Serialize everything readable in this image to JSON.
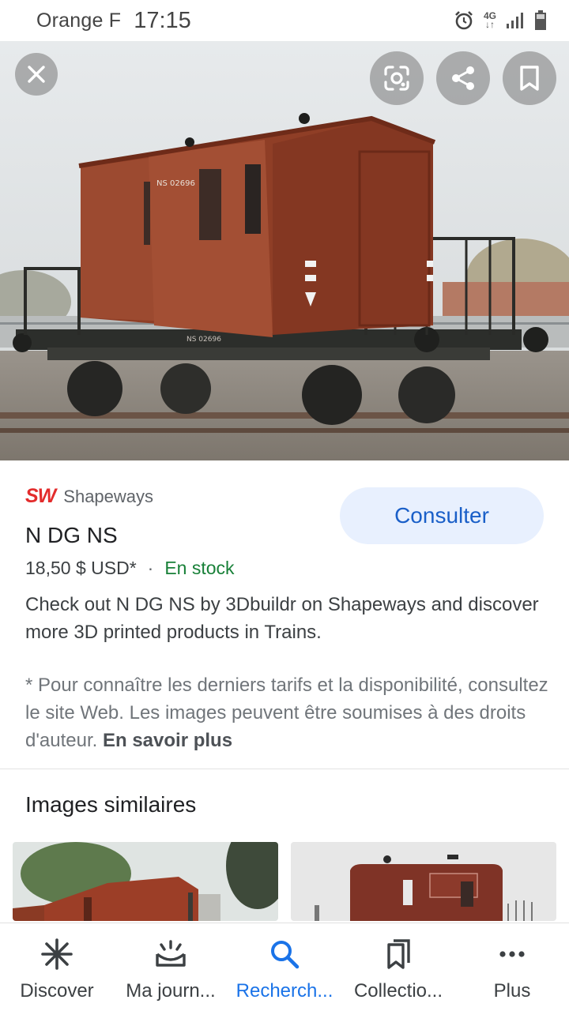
{
  "status_bar": {
    "carrier": "Orange F",
    "time": "17:15",
    "network": "4G",
    "icons": [
      "alarm-icon",
      "network-4g-icon",
      "signal-icon",
      "battery-icon"
    ]
  },
  "viewer": {
    "close_icon": "close-icon",
    "actions": [
      "lens-icon",
      "share-icon",
      "bookmark-icon"
    ],
    "image_plate_top": "NS 02696",
    "image_plate_bottom": "NS 02696"
  },
  "result": {
    "source_logo": "SW",
    "source_name": "Shapeways",
    "visit_button": "Consulter",
    "title": "N DG NS",
    "price": "18,50 $ USD*",
    "separator": "·",
    "availability": "En stock",
    "description": "Check out N DG NS by 3Dbuildr on Shapeways and discover more 3D printed products in Trains.",
    "disclaimer": "* Pour connaître les derniers tarifs et la disponibilité, consultez le site Web. Les images peuvent être soumises à des droits d'auteur.",
    "learn_more": "En savoir plus"
  },
  "similar": {
    "title": "Images similaires"
  },
  "bottom_nav": {
    "items": [
      {
        "label": "Discover",
        "icon": "asterisk-icon"
      },
      {
        "label": "Ma journ...",
        "icon": "sunrise-icon"
      },
      {
        "label": "Recherch...",
        "icon": "search-icon"
      },
      {
        "label": "Collectio...",
        "icon": "collections-icon"
      },
      {
        "label": "Plus",
        "icon": "more-icon"
      }
    ],
    "active_index": 2
  },
  "colors": {
    "accent": "#1a73e8",
    "button_bg": "#e8f0fe",
    "stock_green": "#188038",
    "logo_red": "#e32c2c",
    "wagon_red": "#8f3e26"
  }
}
